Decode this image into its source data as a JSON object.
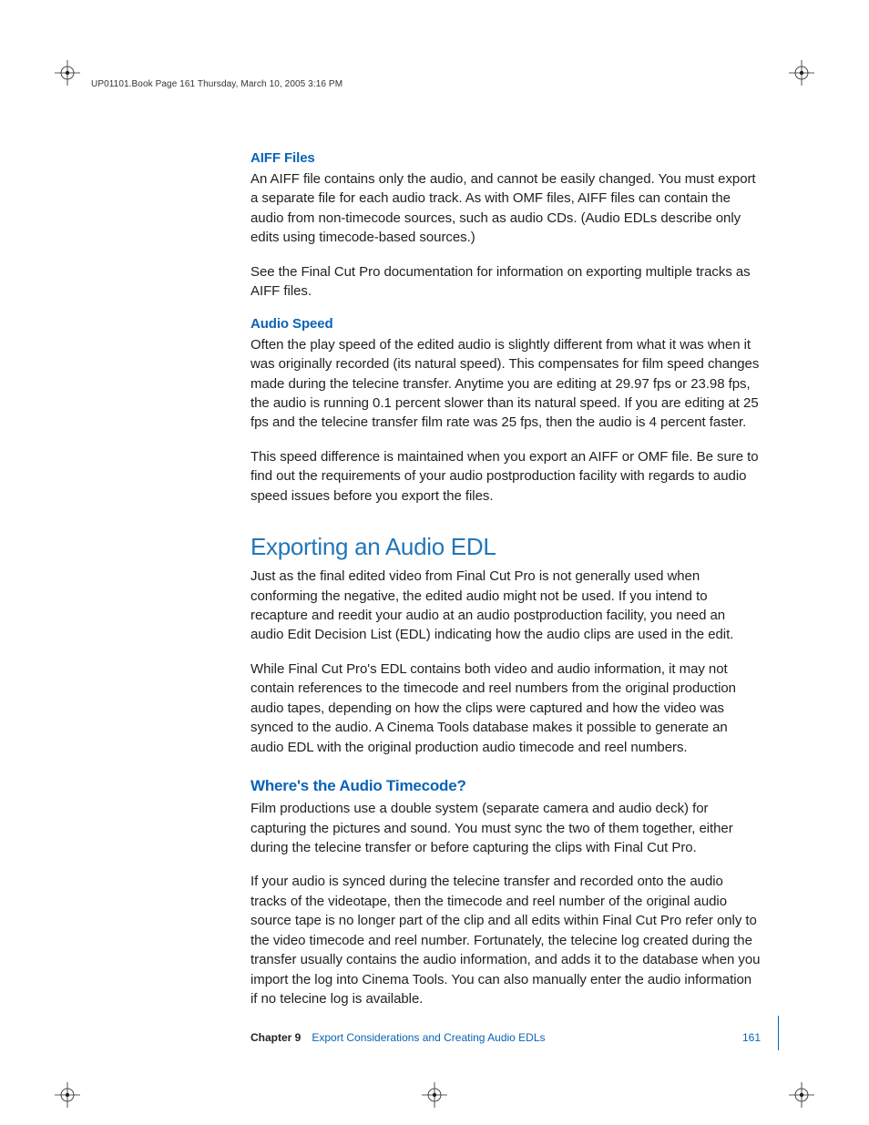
{
  "header": {
    "running": "UP01101.Book  Page 161  Thursday, March 10, 2005  3:16 PM"
  },
  "s1": {
    "title": "AIFF Files",
    "p1": "An AIFF file contains only the audio, and cannot be easily changed. You must export a separate file for each audio track. As with OMF files, AIFF files can contain the audio from non-timecode sources, such as audio CDs. (Audio EDLs describe only edits using timecode-based sources.)",
    "p2": "See the Final Cut Pro documentation for information on exporting multiple tracks as AIFF files."
  },
  "s2": {
    "title": "Audio Speed",
    "p1": "Often the play speed of the edited audio is slightly different from what it was when it was originally recorded (its natural speed). This compensates for film speed changes made during the telecine transfer. Anytime you are editing at 29.97 fps or 23.98 fps, the audio is running 0.1 percent slower than its natural speed. If you are editing at 25 fps and the telecine transfer film rate was 25 fps, then the audio is 4 percent faster.",
    "p2": "This speed difference is maintained when you export an AIFF or OMF file. Be sure to find out the requirements of your audio postproduction facility with regards to audio speed issues before you export the files."
  },
  "s3": {
    "title": "Exporting an Audio EDL",
    "p1": "Just as the final edited video from Final Cut Pro is not generally used when conforming the negative, the edited audio might not be used. If you intend to recapture and reedit your audio at an audio postproduction facility, you need an audio Edit Decision List (EDL) indicating how the audio clips are used in the edit.",
    "p2": "While Final Cut Pro's EDL contains both video and audio information, it may not contain references to the timecode and reel numbers from the original production audio tapes, depending on how the clips were captured and how the video was synced to the audio. A Cinema Tools database makes it possible to generate an audio EDL with the original production audio timecode and reel numbers."
  },
  "s4": {
    "title": "Where's the Audio Timecode?",
    "p1": "Film productions use a double system (separate camera and audio deck) for capturing the pictures and sound. You must sync the two of them together, either during the telecine transfer or before capturing the clips with Final Cut Pro.",
    "p2": "If your audio is synced during the telecine transfer and recorded onto the audio tracks of the videotape, then the timecode and reel number of the original audio source tape is no longer part of the clip and all edits within Final Cut Pro refer only to the video timecode and reel number. Fortunately, the telecine log created during the transfer usually contains the audio information, and adds it to the database when you import the log into Cinema Tools. You can also manually enter the audio information if no telecine log is available."
  },
  "footer": {
    "chapter": "Chapter 9",
    "title": "Export Considerations and Creating Audio EDLs",
    "page": "161"
  }
}
